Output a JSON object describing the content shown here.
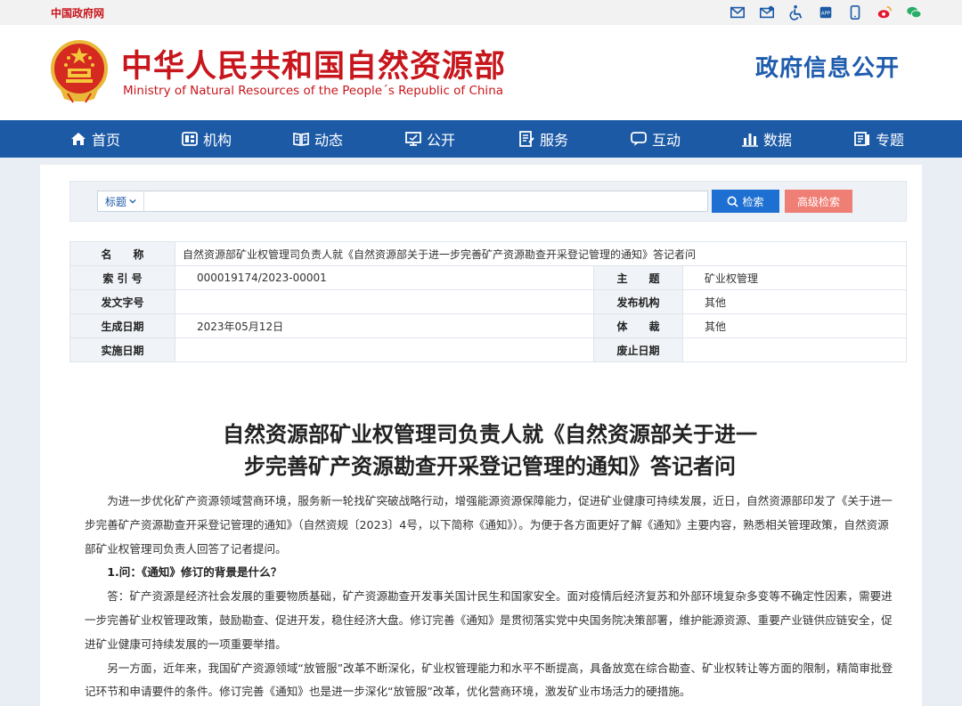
{
  "topbar": {
    "gov_link": "中国政府网",
    "icons": [
      "mail-icon",
      "mailbox-icon",
      "accessibility-icon",
      "app-icon",
      "mobile-icon",
      "weibo-icon",
      "wechat-icon"
    ]
  },
  "header": {
    "title_cn": "中华人民共和国自然资源部",
    "title_en": "Ministry of Natural Resources of the People´s Republic of China",
    "right_title": "政府信息公开"
  },
  "nav": {
    "items": [
      {
        "label": "首页",
        "icon": "home-icon"
      },
      {
        "label": "机构",
        "icon": "org-icon"
      },
      {
        "label": "动态",
        "icon": "news-icon"
      },
      {
        "label": "公开",
        "icon": "public-icon"
      },
      {
        "label": "服务",
        "icon": "service-icon"
      },
      {
        "label": "互动",
        "icon": "chat-icon"
      },
      {
        "label": "数据",
        "icon": "data-icon"
      },
      {
        "label": "专题",
        "icon": "topic-icon"
      }
    ]
  },
  "search": {
    "select_label": "标题",
    "placeholder": "",
    "search_button": "检索",
    "advanced_button": "高级检索"
  },
  "meta": {
    "name_label": "名　　称",
    "name_value": "自然资源部矿业权管理司负责人就《自然资源部关于进一步完善矿产资源勘查开采登记管理的通知》答记者问",
    "index_label": "索 引 号",
    "index_value": "000019174/2023-00001",
    "subject_label": "主　　题",
    "subject_value": "矿业权管理",
    "docno_label": "发文字号",
    "docno_value": "",
    "issuer_label": "发布机构",
    "issuer_value": "其他",
    "date_label": "生成日期",
    "date_value": "2023年05月12日",
    "genre_label": "体　　裁",
    "genre_value": "其他",
    "effective_label": "实施日期",
    "effective_value": "",
    "expire_label": "废止日期",
    "expire_value": ""
  },
  "article": {
    "title_line1": "自然资源部矿业权管理司负责人就《自然资源部关于进一",
    "title_line2": "步完善矿产资源勘查开采登记管理的通知》答记者问",
    "p1": "为进一步优化矿产资源领域营商环境，服务新一轮找矿突破战略行动，增强能源资源保障能力，促进矿业健康可持续发展，近日，自然资源部印发了《关于进一步完善矿产资源勘查开采登记管理的通知》（自然资规〔2023〕4号，以下简称《通知》）。为便于各方面更好了解《通知》主要内容，熟悉相关管理政策，自然资源部矿业权管理司负责人回答了记者提问。",
    "q1": "1.问：《通知》修订的背景是什么？",
    "a1": "答：矿产资源是经济社会发展的重要物质基础，矿产资源勘查开发事关国计民生和国家安全。面对疫情后经济复苏和外部环境复杂多变等不确定性因素，需要进一步完善矿业权管理政策，鼓励勘查、促进开发，稳住经济大盘。修订完善《通知》是贯彻落实党中央国务院决策部署，维护能源资源、重要产业链供应链安全，促进矿业健康可持续发展的一项重要举措。",
    "a2": "另一方面，近年来，我国矿产资源领域“放管服”改革不断深化，矿业权管理能力和水平不断提高，具备放宽在综合勘查、矿业权转让等方面的限制，精简审批登记环节和申请要件的条件。修订完善《通知》也是进一步深化“放管服”改革，优化营商环境，激发矿业市场活力的硬措施。"
  },
  "colors": {
    "brand_red": "#c8161d",
    "nav_blue": "#1c5aa6",
    "search_blue": "#1e6fd2",
    "advanced_red": "#ef7e75"
  }
}
